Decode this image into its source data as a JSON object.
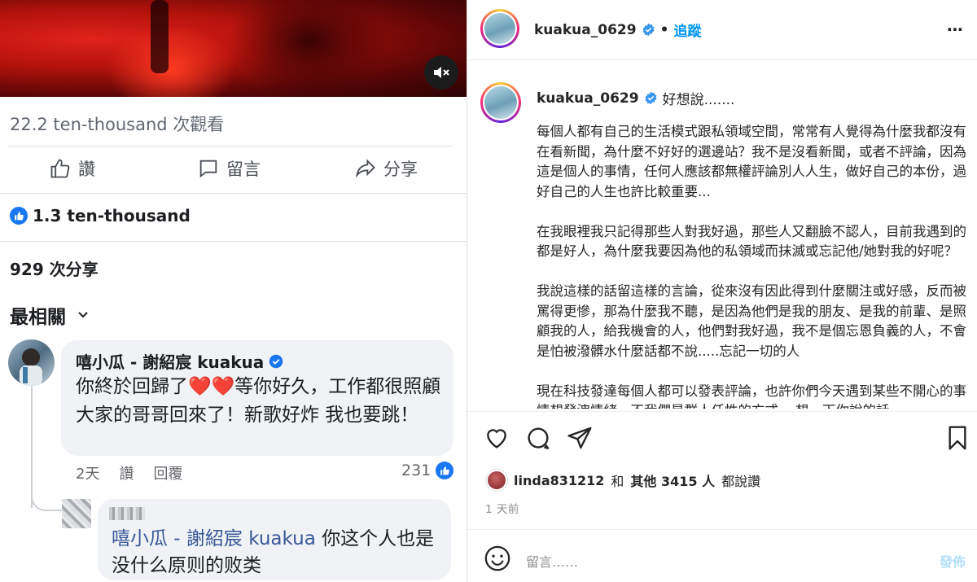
{
  "facebook": {
    "views_text": "22.2 ten-thousand 次觀看",
    "actions": {
      "like": "讚",
      "comment": "留言",
      "share": "分享"
    },
    "reactions_count": "1.3 ten-thousand",
    "shares_text": "929 次分享",
    "sort_label": "最相關",
    "comment1": {
      "author": "嘻小瓜 - 謝紹宸 kuakua",
      "text_before": "你終於回歸了",
      "hearts": "❤️❤️",
      "text_after": "等你好久，工作都很照顧大家的哥哥回來了！新歌好炸 我也要跳！",
      "time": "2天",
      "like_action": "讚",
      "reply_action": "回覆",
      "reaction_count": "231"
    },
    "comment2": {
      "mention": "嘻小瓜 - 謝紹宸 kuakua",
      "text": " 你这个人也是没什么原则的败类"
    },
    "colors": {
      "fb_blue": "#1877f2",
      "mention": "#385898"
    }
  },
  "instagram": {
    "username": "kuakua_0629",
    "separator": "•",
    "follow_label": "追蹤",
    "more_icon": "⋯",
    "caption_first": "好想說.......",
    "caption_paragraphs": [
      "每個人都有自己的生活模式跟私領域空間，常常有人覺得為什麼我都沒有在看新聞，為什麼不好好的選邊站？我不是沒看新聞，或者不評論，因為這是個人的事情，任何人應該都無權評論別人人生，做好自己的本份，過好自己的人生也許比較重要...",
      "在我眼裡我只記得那些人對我好過，那些人又翻臉不認人，目前我遇到的都是好人，為什麼我要因為他的私領域而抹滅或忘記他/她對我的好呢？",
      "我說這樣的話留這樣的言論，從來沒有因此得到什麼關注或好感，反而被罵得更慘，那為什麼我不聽，是因為他們是我的朋友、是我的前輩、是照顧我的人，給我機會的人，他們對我好過，我不是個忘恩負義的人，不會是怕被潑髒水什麼話都不說.....忘記一切的人",
      "現在科技發達每個人都可以發表評論，也許你們今天遇到某些不開心的事情想發洩情緒，不我們是群人任性的方式... 想一下你說的話..."
    ],
    "likes": {
      "user": "linda831212",
      "and": "和",
      "others": "其他 3415 人",
      "suffix": "都說讚"
    },
    "time_ago": "1 天前",
    "comment_placeholder": "留言……",
    "post_label": "發佈",
    "colors": {
      "link": "#0095f6",
      "post_disabled": "#b2dffc",
      "verified": "#3897f0"
    }
  }
}
